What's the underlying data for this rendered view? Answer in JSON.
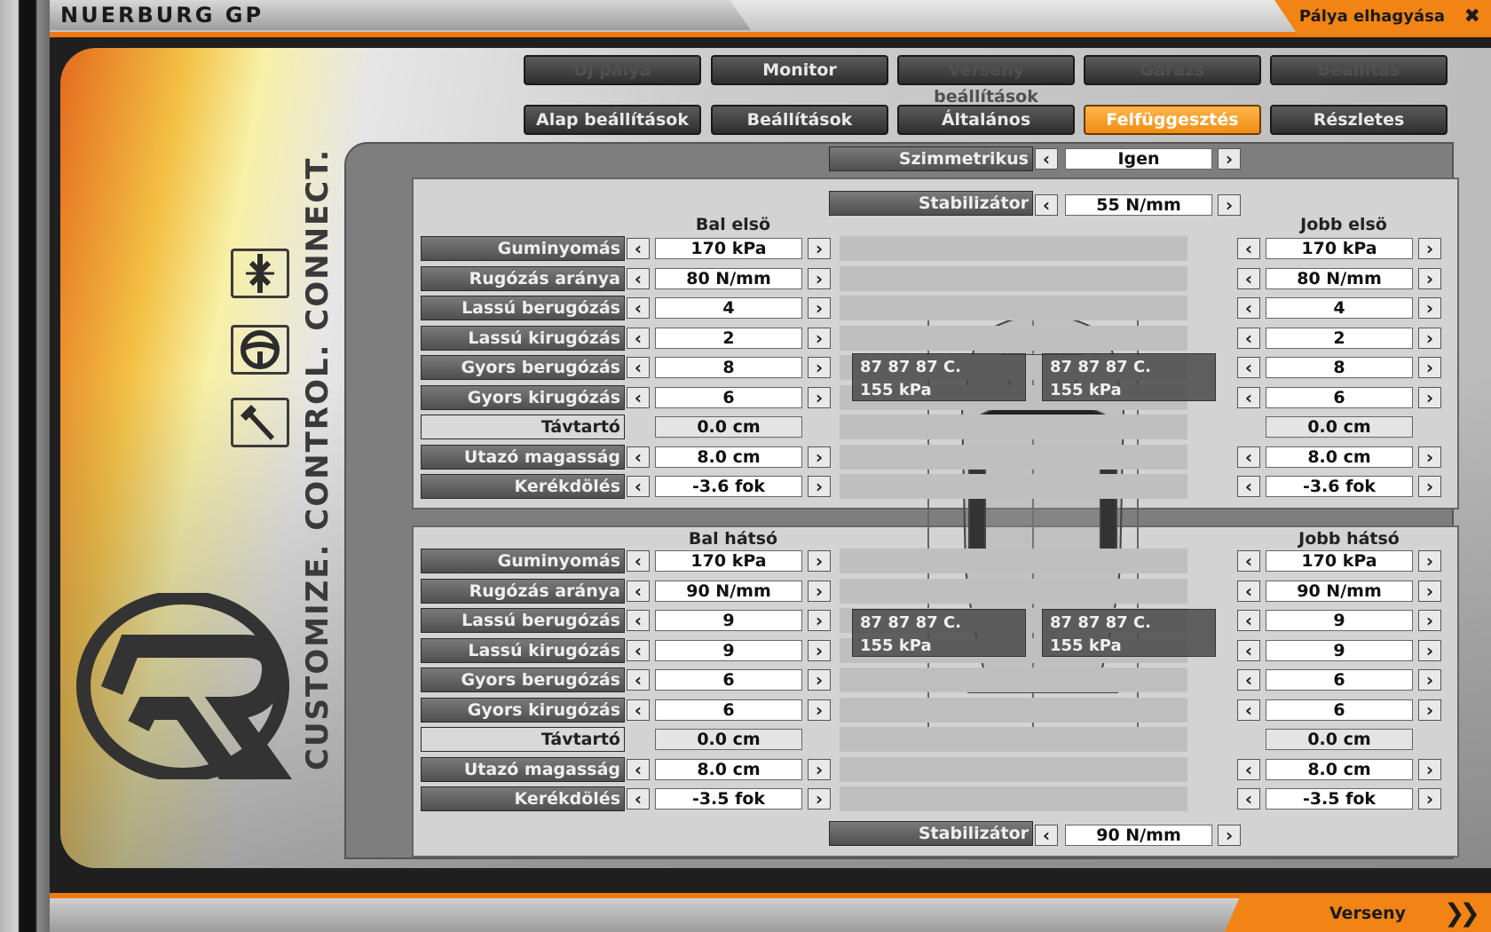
{
  "header": {
    "track_title": "NUERBURG GP",
    "leave_track": "Pálya elhagyása"
  },
  "main_tabs": [
    {
      "label": "Új pálya",
      "state": "disabled"
    },
    {
      "label": "Monitor",
      "state": "enabled"
    },
    {
      "label": "Verseny beállítások",
      "state": "disabled"
    },
    {
      "label": "Garázs",
      "state": "disabled"
    },
    {
      "label": "Beállítás",
      "state": "disabled"
    }
  ],
  "sub_tabs": [
    {
      "label": "Alap beállítások"
    },
    {
      "label": "Beállítások"
    },
    {
      "label": "Általános"
    },
    {
      "label": "Felfüggesztés",
      "active": true
    },
    {
      "label": "Részletes"
    }
  ],
  "side": {
    "slogan": "CUSTOMIZE. CONTROL. CONNECT."
  },
  "symmetric": {
    "label": "Szimmetrikus",
    "value": "Igen"
  },
  "front": {
    "stabilizer": {
      "label": "Stabilizátor",
      "value": "55 N/mm"
    },
    "left_title": "Bal elsö",
    "right_title": "Jobb elsö",
    "rows": [
      {
        "label": "Guminyomás",
        "left": "170 kPa",
        "right": "170 kPa"
      },
      {
        "label": "Rugózás aránya",
        "left": "80 N/mm",
        "right": "80 N/mm"
      },
      {
        "label": "Lassú berugózás",
        "left": "4",
        "right": "4"
      },
      {
        "label": "Lassú kirugózás",
        "left": "2",
        "right": "2"
      },
      {
        "label": "Gyors berugózás",
        "left": "8",
        "right": "8"
      },
      {
        "label": "Gyors kirugózás",
        "left": "6",
        "right": "6"
      },
      {
        "label": "Távtartó",
        "left": "0.0 cm",
        "right": "0.0 cm",
        "readonly": true
      },
      {
        "label": "Utazó magasság",
        "left": "8.0 cm",
        "right": "8.0 cm"
      },
      {
        "label": "Kerékdölés",
        "left": "-3.6 fok",
        "right": "-3.6 fok"
      }
    ],
    "tyre_left": {
      "temps": "87  87  87 C.",
      "pressure": "155 kPa"
    },
    "tyre_right": {
      "temps": "87  87  87 C.",
      "pressure": "155 kPa"
    }
  },
  "rear": {
    "stabilizer": {
      "label": "Stabilizátor",
      "value": "90 N/mm"
    },
    "left_title": "Bal hátsó",
    "right_title": "Jobb hátsó",
    "rows": [
      {
        "label": "Guminyomás",
        "left": "170 kPa",
        "right": "170 kPa"
      },
      {
        "label": "Rugózás aránya",
        "left": "90 N/mm",
        "right": "90 N/mm"
      },
      {
        "label": "Lassú berugózás",
        "left": "9",
        "right": "9"
      },
      {
        "label": "Lassú kirugózás",
        "left": "9",
        "right": "9"
      },
      {
        "label": "Gyors berugózás",
        "left": "6",
        "right": "6"
      },
      {
        "label": "Gyors kirugózás",
        "left": "6",
        "right": "6"
      },
      {
        "label": "Távtartó",
        "left": "0.0 cm",
        "right": "0.0 cm",
        "readonly": true
      },
      {
        "label": "Utazó magasság",
        "left": "8.0 cm",
        "right": "8.0 cm"
      },
      {
        "label": "Kerékdölés",
        "left": "-3.5 fok",
        "right": "-3.5 fok"
      }
    ],
    "tyre_left": {
      "temps": "87  87  87 C.",
      "pressure": "155 kPa"
    },
    "tyre_right": {
      "temps": "87  87  87 C.",
      "pressure": "155 kPa"
    }
  },
  "footer": {
    "race_label": "Verseny"
  },
  "colors": {
    "accent": "#f18414",
    "active_tab": "#f5a030"
  }
}
